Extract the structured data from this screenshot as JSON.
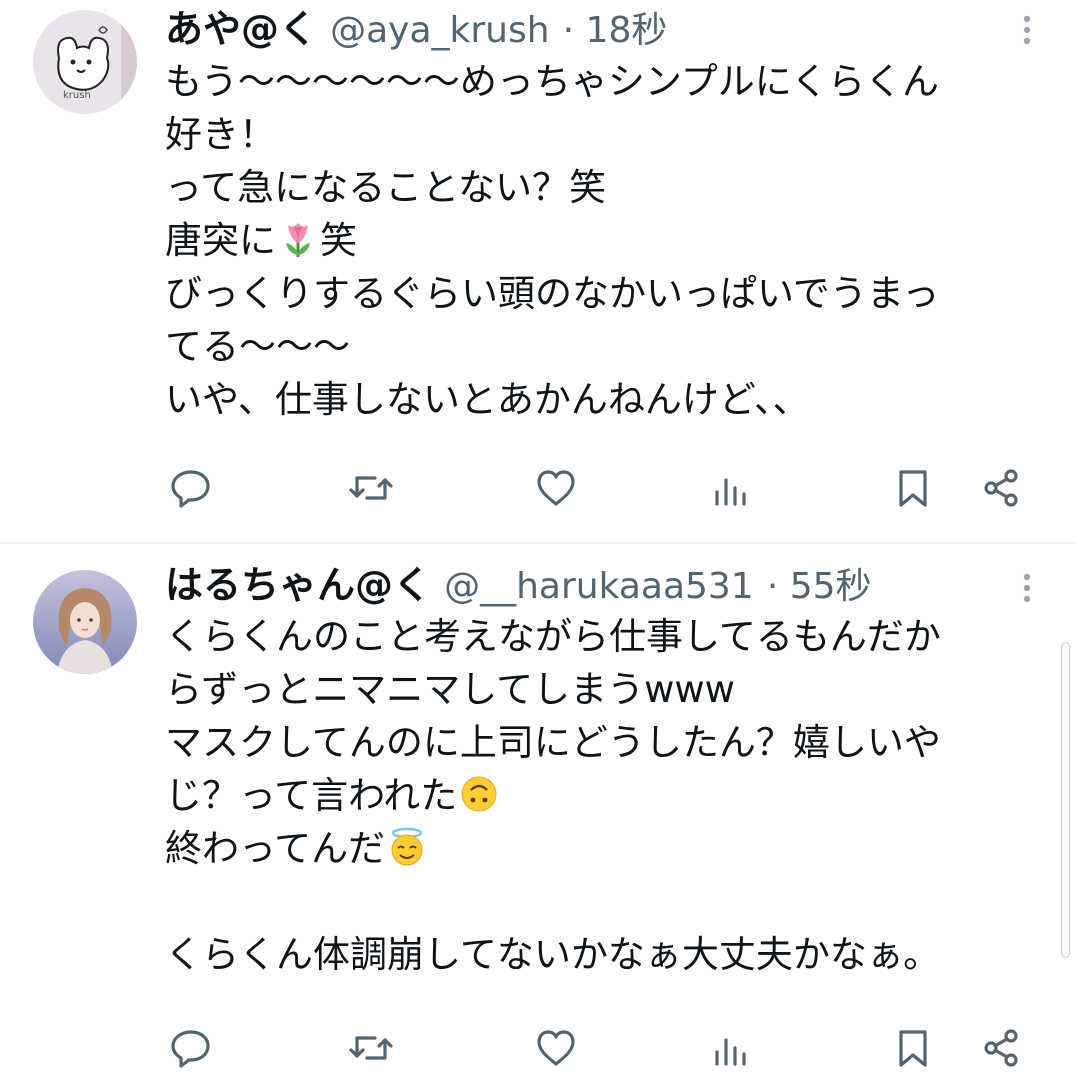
{
  "tweets": [
    {
      "display_name": "あや@く",
      "handle": "@aya_krush",
      "time": "· 18秒",
      "avatar_text": "krush",
      "lines": [
        "もう〜〜〜〜〜〜めっちゃシンプルにくらくん",
        "好き！",
        "って急になることない？笑",
        "唐突に",
        "笑",
        "びっくりするぐらい頭のなかいっぱいでうまっ",
        "てる〜〜〜",
        "いや、仕事しないとあかんねんけど、、"
      ],
      "emojis": [
        "tulip-emoji"
      ]
    },
    {
      "display_name": "はるちゃん@く",
      "handle": "@__harukaaa531",
      "time": "· 55秒",
      "lines": [
        "くらくんのこと考えながら仕事してるもんだか",
        "らずっとニマニマしてしまうwww",
        "マスクしてんのに上司にどうしたん？嬉しいや",
        "じ？って言われた",
        "終わってんだ",
        "",
        "くらくん体調崩してないかなぁ大丈夫かなぁ。"
      ],
      "emojis": [
        "upside-down-face-emoji",
        "smiling-face-with-halo-emoji"
      ]
    }
  ],
  "icons": {
    "reply": "reply-icon",
    "retweet": "retweet-icon",
    "like": "like-icon",
    "views": "views-icon",
    "bookmark": "bookmark-icon",
    "share": "share-icon",
    "more": "more-vertical-icon"
  },
  "colors": {
    "text": "#0f1419",
    "secondary": "#536471",
    "divider": "#eff3f4"
  }
}
